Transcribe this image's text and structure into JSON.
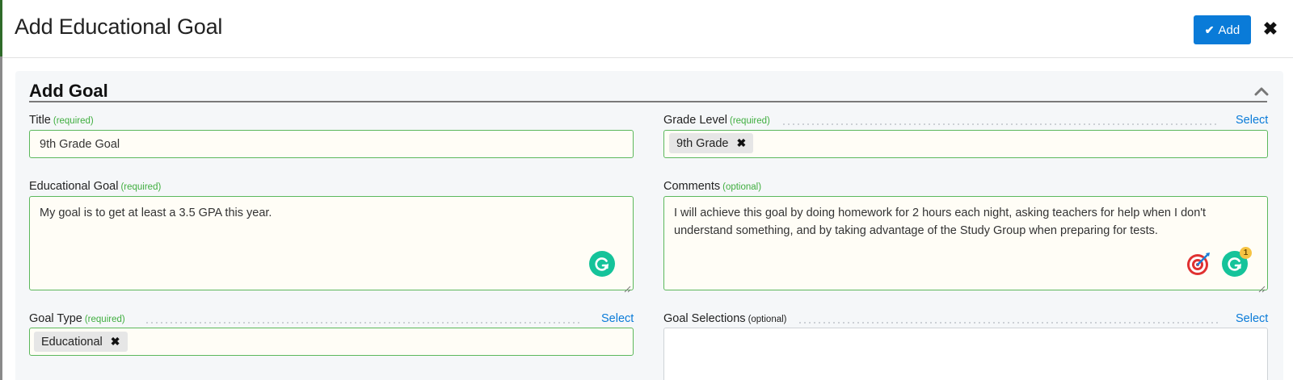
{
  "modal": {
    "title": "Add Educational Goal",
    "add_label": "Add",
    "check_glyph": "✔",
    "close_glyph": "✖"
  },
  "section": {
    "title": "Add Goal"
  },
  "fields": {
    "title": {
      "label": "Title",
      "qualifier": "(required)",
      "value": "9th Grade Goal"
    },
    "grade_level": {
      "label": "Grade Level",
      "qualifier": "(required)",
      "select_label": "Select",
      "chip": "9th Grade"
    },
    "educational_goal": {
      "label": "Educational Goal",
      "qualifier": "(required)",
      "value": "My goal is to get at least a 3.5 GPA this year."
    },
    "comments": {
      "label": "Comments",
      "qualifier": "(optional)",
      "value": "I will achieve this goal by doing homework for 2 hours each night, asking teachers for help when I don't understand something, and by taking advantage of the Study Group when preparing for tests.",
      "grammarly_count": "1"
    },
    "goal_type": {
      "label": "Goal Type",
      "qualifier": "(required)",
      "select_label": "Select",
      "chip": "Educational"
    },
    "goal_selections": {
      "label": "Goal Selections",
      "qualifier": "(optional)",
      "select_label": "Select"
    }
  },
  "chip_remove_glyph": "✖",
  "icons": {
    "check": "check-icon",
    "close": "close-icon",
    "collapse": "chevron-up-icon",
    "grammarly": "grammarly-icon",
    "target": "target-icon",
    "remove": "remove-icon"
  },
  "colors": {
    "primary": "#0a7bd8",
    "valid_border": "#5cb85c",
    "required_text": "#3fae3f",
    "grammarly": "#15c39a",
    "panel_bg": "#f5f7f9"
  }
}
